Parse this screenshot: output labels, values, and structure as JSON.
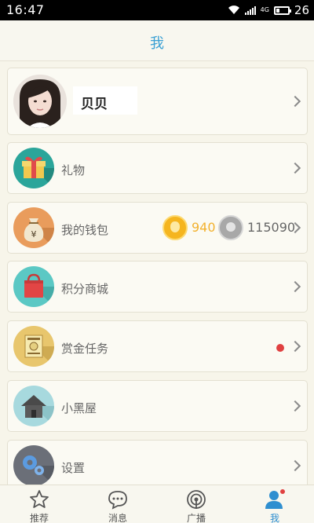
{
  "status_bar": {
    "time": "16:47",
    "network_label": "4G",
    "battery_level": "26"
  },
  "header": {
    "title": "我"
  },
  "profile": {
    "name": "贝贝"
  },
  "menu": {
    "gift": {
      "label": "礼物",
      "icon": "gift-icon"
    },
    "wallet": {
      "label": "我的钱包",
      "icon": "money-bag-icon",
      "gold_coins": "940",
      "silver_coins": "115090"
    },
    "points_mall": {
      "label": "积分商城",
      "icon": "shopping-bag-icon"
    },
    "bounty_tasks": {
      "label": "赏金任务",
      "icon": "wanted-poster-icon",
      "has_notification": true
    },
    "dark_room": {
      "label": "小黑屋",
      "icon": "house-icon"
    },
    "settings": {
      "label": "设置",
      "icon": "gear-icon"
    }
  },
  "tabbar": {
    "tabs": [
      {
        "label": "推荐",
        "icon": "star-icon"
      },
      {
        "label": "消息",
        "icon": "chat-icon"
      },
      {
        "label": "广播",
        "icon": "broadcast-icon"
      },
      {
        "label": "我",
        "icon": "person-icon",
        "active": true
      }
    ]
  },
  "colors": {
    "accent": "#3aa0d4",
    "gold": "#f2b12e",
    "notification": "#e04040",
    "background": "#f7f5ea"
  }
}
